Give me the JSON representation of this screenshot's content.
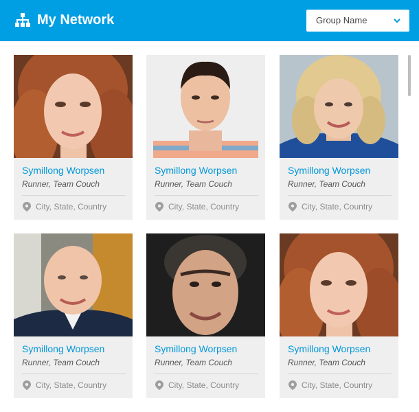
{
  "header": {
    "title": "My Network",
    "icon": "network-icon",
    "color": "#009ee3"
  },
  "group_select": {
    "value": "Group Name",
    "icon": "chevron-down-icon"
  },
  "accent_color": "#0097d8",
  "cards": [
    {
      "name": "Symillong Worpsen",
      "role": "Runner, Team Couch",
      "location": "City, State, Country",
      "photo": "portrait-woman-red-curly-hair"
    },
    {
      "name": "Symillong Worpsen",
      "role": "Runner, Team Couch",
      "location": "City, State, Country",
      "photo": "portrait-young-man-dark-hair"
    },
    {
      "name": "Symillong Worpsen",
      "role": "Runner, Team Couch",
      "location": "City, State, Country",
      "photo": "portrait-woman-blonde-hair"
    },
    {
      "name": "Symillong Worpsen",
      "role": "Runner, Team Couch",
      "location": "City, State, Country",
      "photo": "portrait-bald-man"
    },
    {
      "name": "Symillong Worpsen",
      "role": "Runner, Team Couch",
      "location": "City, State, Country",
      "photo": "portrait-man-gray-hair"
    },
    {
      "name": "Symillong Worpsen",
      "role": "Runner, Team Couch",
      "location": "City, State, Country",
      "photo": "portrait-woman-red-curly-hair"
    }
  ]
}
